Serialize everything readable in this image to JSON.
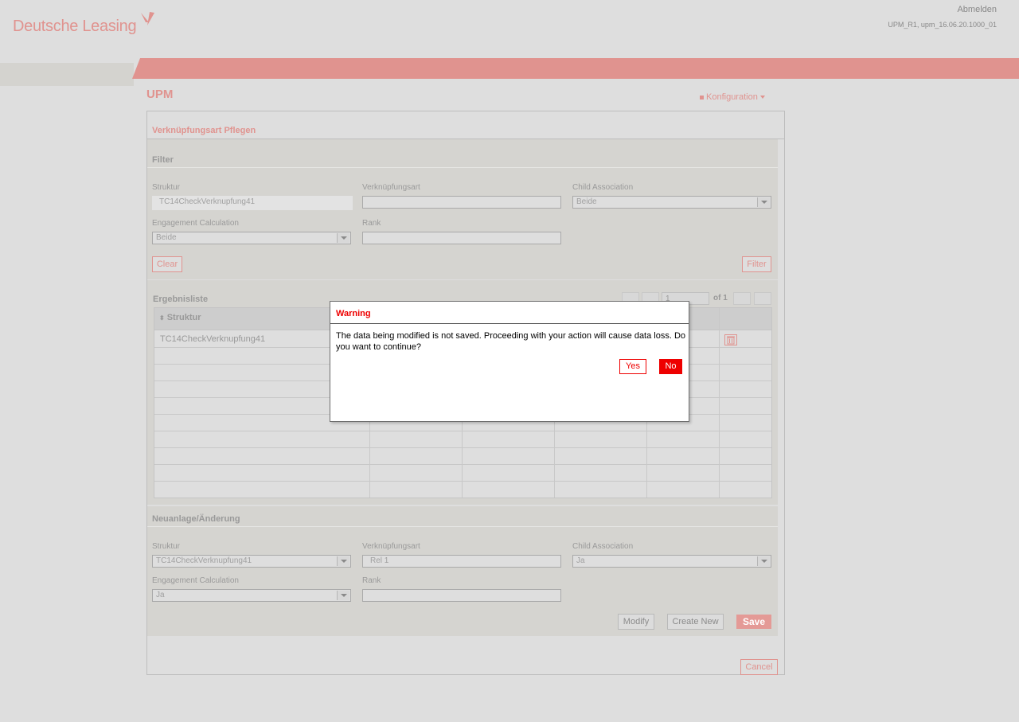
{
  "header": {
    "brand": "Deutsche Leasing",
    "logout_label": "Abmelden",
    "version": "UPM_R1, upm_16.06.20.1000_01"
  },
  "app": {
    "title": "UPM",
    "menu_label": "Konfiguration"
  },
  "panel": {
    "title": "Verknüpfungsart Pflegen"
  },
  "filter": {
    "heading": "Filter",
    "struktur_label": "Struktur",
    "struktur_value": "TC14CheckVerknupfung41",
    "verknuepfungsart_label": "Verknüpfungsart",
    "verknuepfungsart_value": "",
    "child_association_label": "Child Association",
    "child_association_value": "Beide",
    "engagement_label": "Engagement Calculation",
    "engagement_value": "Beide",
    "rank_label": "Rank",
    "rank_value": "",
    "clear_label": "Clear",
    "filter_label": "Filter"
  },
  "results": {
    "heading": "Ergebnisliste",
    "page_value": "1",
    "page_of": "of 1",
    "column_struktur": "Struktur",
    "sort_icon": "⬍",
    "rows": [
      {
        "struktur": "TC14CheckVerknupfung41"
      }
    ]
  },
  "edit": {
    "heading": "Neuanlage/Änderung",
    "struktur_label": "Struktur",
    "struktur_value": "TC14CheckVerknupfung41",
    "verknuepfungsart_label": "Verknüpfungsart",
    "verknuepfungsart_value": "Rel 1",
    "child_association_label": "Child Association",
    "child_association_value": "Ja",
    "engagement_label": "Engagement Calculation",
    "engagement_value": "Ja",
    "rank_label": "Rank",
    "rank_value": "",
    "modify_label": "Modify",
    "create_new_label": "Create New",
    "save_label": "Save"
  },
  "cancel_label": "Cancel",
  "dialog": {
    "title": "Warning",
    "message": "The data being modified is not saved. Proceeding with your action will cause data loss. Do you want to continue?",
    "yes_label": "Yes",
    "no_label": "No"
  },
  "colors": {
    "brand": "#e0938f",
    "warning": "#ee0000"
  }
}
